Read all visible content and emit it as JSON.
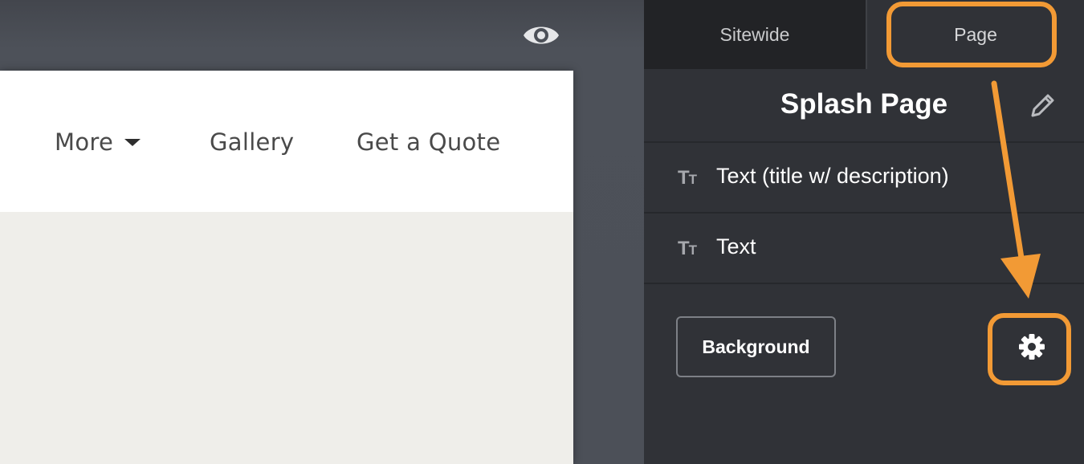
{
  "colors": {
    "accent_annotation": "#f29a35",
    "sidebar_bg": "#303237",
    "tab_inactive_bg": "#222326",
    "canvas_bg": "#4c5058",
    "site_header_bg": "#ffffff",
    "site_body_bg": "#efeeea"
  },
  "preview": {
    "eye_icon": "eye-icon",
    "nav": {
      "more_label": "More",
      "gallery_label": "Gallery",
      "quote_label": "Get a Quote"
    }
  },
  "sidebar": {
    "tabs": [
      {
        "label": "Sitewide",
        "active": false
      },
      {
        "label": "Page",
        "active": true
      }
    ],
    "page_title": "Splash Page",
    "edit_icon": "pencil-icon",
    "sections": [
      {
        "icon": "text-size-icon",
        "label": "Text (title w/ description)"
      },
      {
        "icon": "text-size-icon",
        "label": "Text"
      }
    ],
    "background_label": "Background",
    "settings_icon": "gear-icon"
  }
}
